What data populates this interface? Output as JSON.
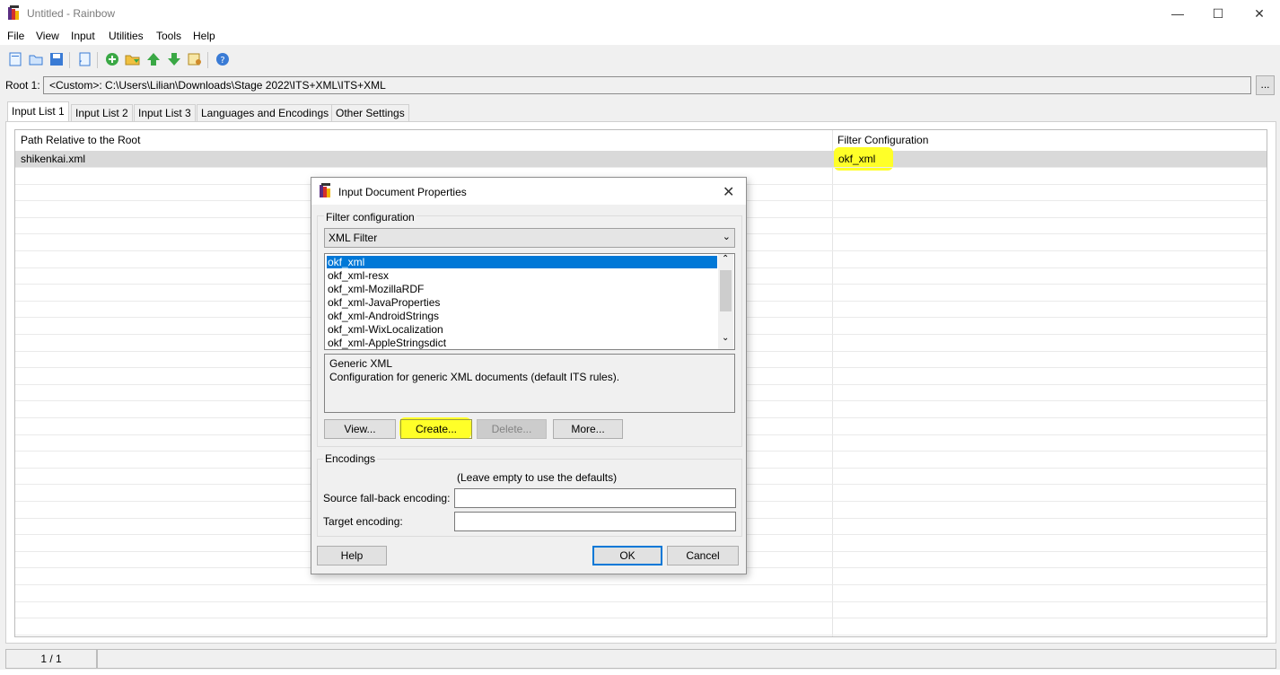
{
  "window": {
    "title": "Untitled - Rainbow"
  },
  "menu": [
    "File",
    "View",
    "Input",
    "Utilities",
    "Tools",
    "Help"
  ],
  "toolbar": {
    "icons": [
      "new-icon",
      "open-icon",
      "save-icon",
      "edit-icon",
      "add-icon",
      "add-folder-icon",
      "move-up-icon",
      "move-down-icon",
      "settings-icon",
      "help-icon"
    ]
  },
  "root": {
    "label": "Root 1:",
    "path": "<Custom>:  C:\\Users\\Lilian\\Downloads\\Stage 2022\\ITS+XML\\ITS+XML",
    "browse_label": "..."
  },
  "tabs": [
    "Input List 1",
    "Input List 2",
    "Input List 3",
    "Languages and Encodings",
    "Other Settings"
  ],
  "table": {
    "headers": [
      "Path Relative to the Root",
      "Filter Configuration"
    ],
    "rows": [
      {
        "path": "shikenkai.xml",
        "filter": "okf_xml"
      }
    ]
  },
  "status": {
    "page": "1 / 1"
  },
  "dialog": {
    "title": "Input Document Properties",
    "filter_group_label": "Filter configuration",
    "filter_selected": "XML Filter",
    "config_items": [
      "okf_xml",
      "okf_xml-resx",
      "okf_xml-MozillaRDF",
      "okf_xml-JavaProperties",
      "okf_xml-AndroidStrings",
      "okf_xml-WixLocalization",
      "okf_xml-AppleStringsdict"
    ],
    "description_title": "Generic XML",
    "description_text": "Configuration for generic XML documents (default ITS rules).",
    "buttons": {
      "view": "View...",
      "create": "Create...",
      "delete": "Delete...",
      "more": "More...",
      "help": "Help",
      "ok": "OK",
      "cancel": "Cancel"
    },
    "encodings_label": "Encodings",
    "encodings_hint": "(Leave empty to use the defaults)",
    "source_label": "Source fall-back encoding:",
    "target_label": "Target encoding:",
    "source_value": "",
    "target_value": ""
  },
  "colors": {
    "highlight": "#ffff28",
    "selection": "#0078d7"
  }
}
